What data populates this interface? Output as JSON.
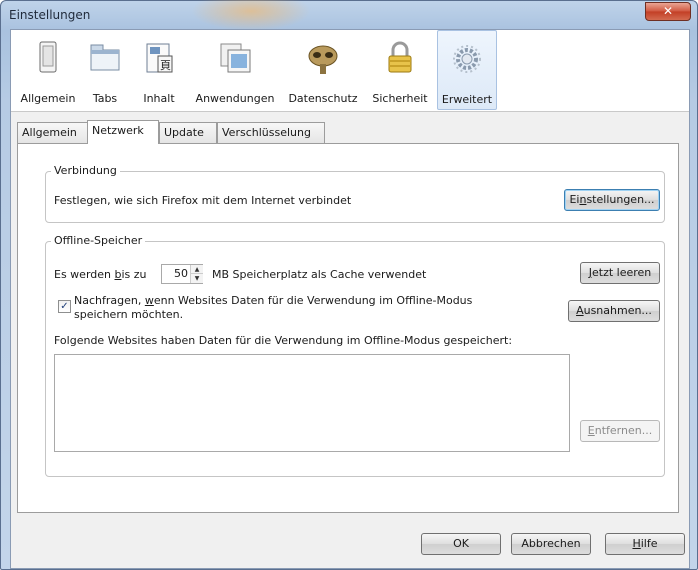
{
  "window": {
    "title": "Einstellungen",
    "close_glyph": "✕"
  },
  "toolbar": {
    "items": [
      {
        "label": "Allgemein",
        "icon": "general-switch-icon"
      },
      {
        "label": "Tabs",
        "icon": "tabs-icon"
      },
      {
        "label": "Inhalt",
        "icon": "content-icon"
      },
      {
        "label": "Anwendungen",
        "icon": "applications-icon"
      },
      {
        "label": "Datenschutz",
        "icon": "privacy-mask-icon"
      },
      {
        "label": "Sicherheit",
        "icon": "padlock-icon"
      },
      {
        "label": "Erweitert",
        "icon": "advanced-gear-icon",
        "selected": true
      }
    ]
  },
  "subtabs": [
    {
      "label": "Allgemein"
    },
    {
      "label": "Netzwerk",
      "active": true
    },
    {
      "label": "Update"
    },
    {
      "label": "Verschlüsselung"
    }
  ],
  "connection": {
    "legend": "Verbindung",
    "description": "Festlegen, wie sich Firefox mit dem Internet verbindet",
    "settings_button": {
      "before": "Ei",
      "mnemonic": "n",
      "after": "stellungen..."
    }
  },
  "offline": {
    "legend": "Offline-Speicher",
    "cache_prefix": "Es werden ",
    "cache_mnemonic": "b",
    "cache_prefix_rest": "is zu",
    "cache_value": "50",
    "cache_suffix": "MB Speicherplatz als Cache verwendet",
    "clear_button": {
      "mnemonic": "J",
      "after": "etzt leeren"
    },
    "ask_checkbox_checked": true,
    "ask_line1_before": "Nachfragen, ",
    "ask_line1_mnemonic": "w",
    "ask_line1_after": "enn Websites Daten für die Verwendung im Offline-Modus",
    "ask_line2": "speichern möchten.",
    "exceptions_button": {
      "mnemonic": "A",
      "after": "usnahmen..."
    },
    "sites_label": "Folgende Websites haben Daten für die Verwendung im Offline-Modus gespeichert:",
    "remove_button": {
      "mnemonic": "E",
      "after": "ntfernen..."
    }
  },
  "footer": {
    "ok": "OK",
    "cancel": "Abbrechen",
    "help": {
      "mnemonic": "H",
      "after": "ilfe"
    }
  },
  "colors": {
    "accent": "#3c7fb1",
    "selected_tab_bg": "#dde9f7",
    "close_red": "#c23e25"
  }
}
